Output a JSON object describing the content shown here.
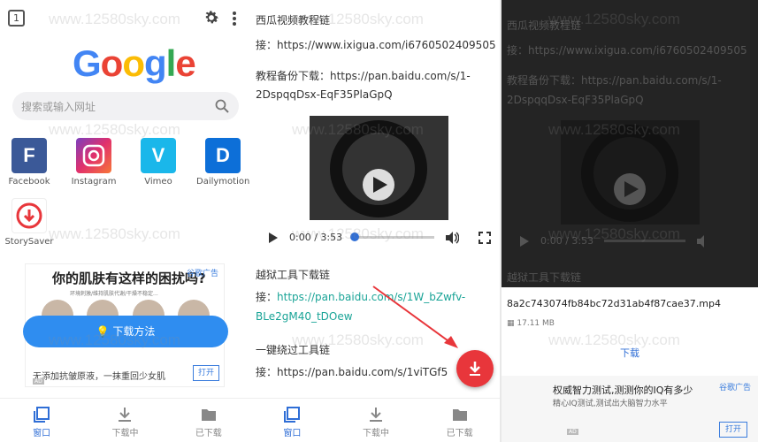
{
  "colors": {
    "accent": "#2f6ed6",
    "fab": "#e8363b",
    "link": "#1aa497"
  },
  "panel1": {
    "tab_count": "1",
    "search_placeholder": "搜索或输入网址",
    "logo": [
      "G",
      "o",
      "o",
      "g",
      "l",
      "e"
    ],
    "shortcuts": [
      {
        "label": "Facebook",
        "glyph": "F"
      },
      {
        "label": "Instagram",
        "glyph": ""
      },
      {
        "label": "Vimeo",
        "glyph": "V"
      },
      {
        "label": "Dailymotion",
        "glyph": "D"
      },
      {
        "label": "StorySaver",
        "glyph": ""
      }
    ],
    "ad": {
      "headline": "你的肌肤有这样的困扰吗?",
      "subline": "环境刺激/维持肌肤代谢/干燥不稳定...",
      "tag": "谷歌广告",
      "button": "下载方法",
      "desc": "无添加抗皱原液，一抹重回少女肌",
      "open": "打开",
      "ad_label": "AD"
    },
    "nav": [
      "窗口",
      "下载中",
      "已下载"
    ]
  },
  "panel2": {
    "lines": {
      "l1": "西瓜视频教程链",
      "l2": "接：https://www.ixigua.com/i6760502409505",
      "l3": "教程备份下载：https://pan.baidu.com/s/1-",
      "l4": "2DspqqDsx-EqF35PlaGpQ",
      "l5": "越狱工具下载链",
      "l6_pre": "接：",
      "l6_link": "https://pan.baidu.com/s/1W_bZwfv-",
      "l7_link": "BLe2gM40_tDOew",
      "l8": "一键绕过工具链",
      "l9": "接：https://pan.baidu.com/s/1viTGf5"
    },
    "audio_time": "0:00 / 3:53",
    "audio_progress": 0.0,
    "nav": [
      "窗口",
      "下载中",
      "已下载"
    ]
  },
  "panel3": {
    "lines": {
      "l1": "西瓜视频教程链",
      "l2": "接：https://www.ixigua.com/i6760502409505",
      "l3": "教程备份下载：https://pan.baidu.com/s/1-",
      "l4": "2DspqqDsx-EqF35PlaGpQ",
      "l5": "越狱工具下载链"
    },
    "audio_time": "0:00 / 3:53",
    "file_name": "8a2c743074fb84bc72d31ab4f87cae37.mp4",
    "file_size": "17.11 MB",
    "download": "下载",
    "ad": {
      "headline": "权威智力测试,测测你的IQ有多少",
      "subline": "精心IQ测试,测试出大脑智力水平",
      "tag": "谷歌广告",
      "open": "打开",
      "ad_label": "AD"
    }
  },
  "watermark": "www.12580sky.com"
}
